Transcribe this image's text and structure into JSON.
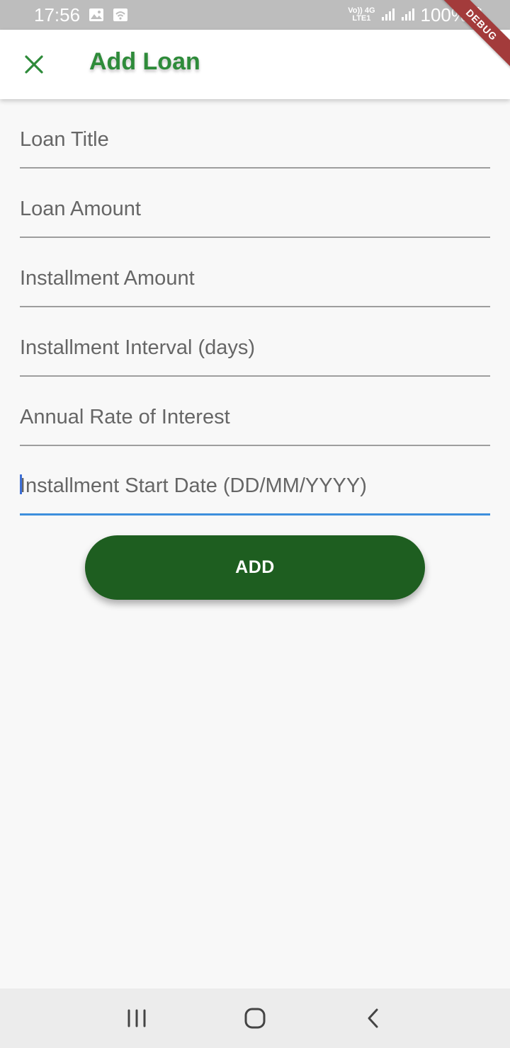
{
  "status_bar": {
    "time": "17:56",
    "network_top": "Vo)) 4G",
    "network_bottom": "LTE1",
    "battery": "100%"
  },
  "debug_banner": "DEBUG",
  "app_bar": {
    "title": "Add Loan",
    "close_icon": "close-icon"
  },
  "form": {
    "fields": [
      {
        "placeholder": "Loan Title",
        "value": ""
      },
      {
        "placeholder": "Loan Amount",
        "value": ""
      },
      {
        "placeholder": "Installment Amount",
        "value": ""
      },
      {
        "placeholder": "Installment Interval (days)",
        "value": ""
      },
      {
        "placeholder": "Annual Rate of Interest",
        "value": ""
      },
      {
        "placeholder": "Installment Start Date (DD/MM/YYYY)",
        "value": ""
      }
    ],
    "submit_label": "ADD"
  },
  "colors": {
    "accent_green": "#2e8b3a",
    "button_green": "#1e5e20",
    "focus_blue": "#3d8fdd"
  },
  "nav_bar": {
    "recents_icon": "recents-icon",
    "home_icon": "home-icon",
    "back_icon": "back-icon"
  }
}
